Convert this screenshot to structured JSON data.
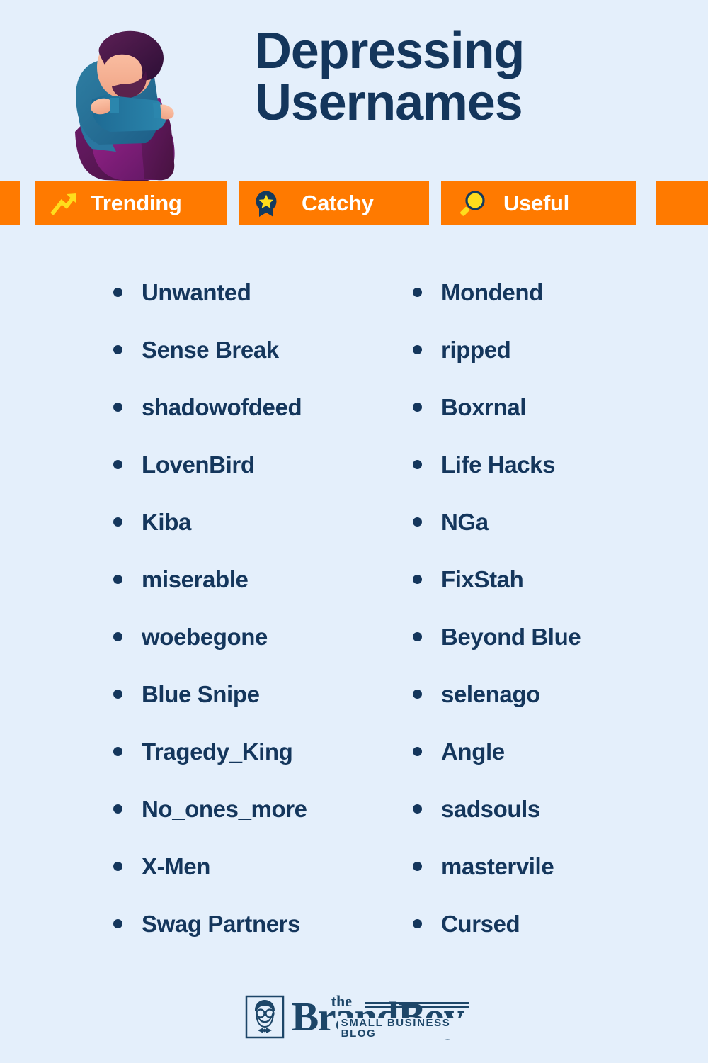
{
  "colors": {
    "background": "#e4effb",
    "accent_orange": "#ff7a00",
    "navy": "#14365c",
    "yellow": "#ffdd1c",
    "white": "#ffffff",
    "logo_navy": "#1d4668"
  },
  "header": {
    "title_line_1": "Depressing",
    "title_line_2": "Usernames",
    "illustration_name": "sad-person-sitting-hugging-knees"
  },
  "badges": [
    {
      "label": "Trending",
      "icon": "trending-up-arrow-icon"
    },
    {
      "label": "Catchy",
      "icon": "award-star-badge-icon"
    },
    {
      "label": "Useful",
      "icon": "magnifying-glass-icon"
    }
  ],
  "list": {
    "left_column": [
      "Unwanted",
      "Sense Break",
      "shadowofdeed",
      "LovenBird",
      "Kiba",
      "miserable",
      "woebegone",
      "Blue Snipe",
      "Tragedy_King",
      "No_ones_more",
      "X-Men",
      "Swag Partners"
    ],
    "right_column": [
      "Mondend",
      "ripped",
      "Boxrnal",
      "Life Hacks",
      "NGa",
      "FixStah",
      "Beyond Blue",
      "selenago",
      "Angle",
      "sadsouls",
      "mastervile",
      "Cursed"
    ]
  },
  "footer": {
    "logo_the": "the",
    "logo_name": "BrandBoy",
    "logo_tagline": "SMALL BUSINESS BLOG",
    "logo_mark_name": "boy-with-glasses-bowtie-icon"
  }
}
